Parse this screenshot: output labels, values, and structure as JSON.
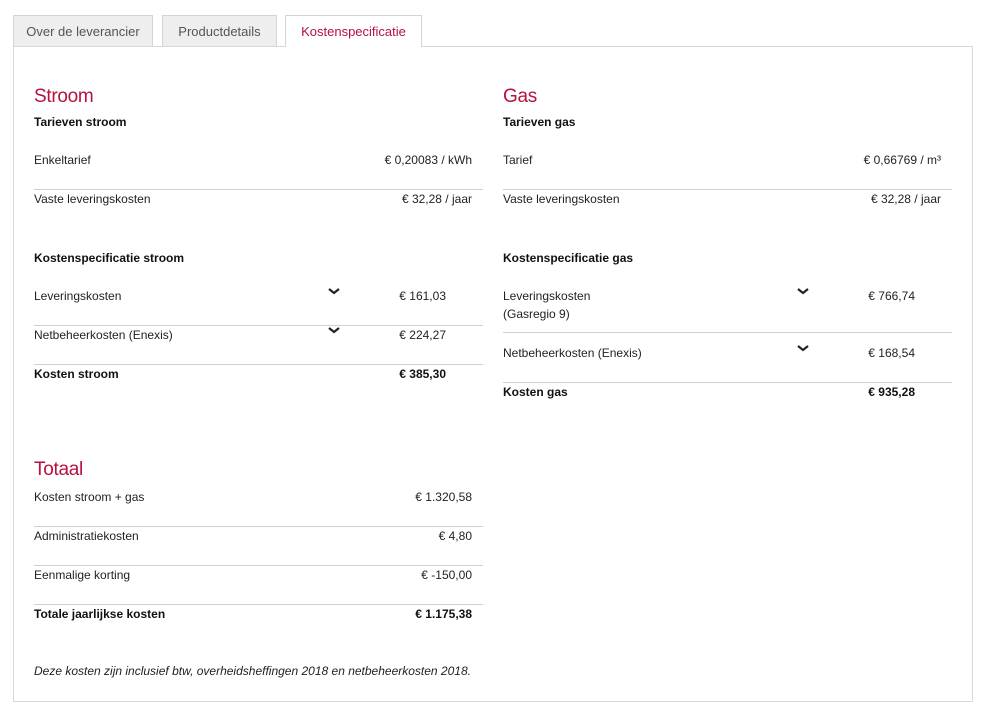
{
  "tabs": [
    {
      "label": "Over de leverancier"
    },
    {
      "label": "Productdetails"
    },
    {
      "label": "Kostenspecificatie"
    }
  ],
  "stroom": {
    "title": "Stroom",
    "tarieven_title": "Tarieven stroom",
    "tarieven": [
      {
        "label": "Enkeltarief",
        "value": "€ 0,20083 / kWh"
      },
      {
        "label": "Vaste leveringskosten",
        "value": "€ 32,28 / jaar"
      }
    ],
    "spec_title": "Kostenspecificatie stroom",
    "spec": [
      {
        "label": "Leveringskosten",
        "value": "€ 161,03"
      },
      {
        "label": "Netbeheerkosten (Enexis)",
        "value": "€ 224,27"
      }
    ],
    "total_label": "Kosten stroom",
    "total_value": "€ 385,30"
  },
  "gas": {
    "title": "Gas",
    "tarieven_title": "Tarieven gas",
    "tarieven": [
      {
        "label": "Tarief",
        "value": "€ 0,66769 / m³"
      },
      {
        "label": "Vaste leveringskosten",
        "value": "€ 32,28 / jaar"
      }
    ],
    "spec_title": "Kostenspecificatie gas",
    "spec": [
      {
        "label": "Leveringskosten",
        "label2": "(Gasregio 9)",
        "value": "€ 766,74"
      },
      {
        "label": "Netbeheerkosten (Enexis)",
        "value": "€ 168,54"
      }
    ],
    "total_label": "Kosten gas",
    "total_value": "€ 935,28"
  },
  "totaal": {
    "title": "Totaal",
    "rows": [
      {
        "label": "Kosten stroom + gas",
        "value": "€ 1.320,58"
      },
      {
        "label": "Administratiekosten",
        "value": "€ 4,80"
      },
      {
        "label": "Eenmalige korting",
        "value": "€ -150,00"
      }
    ],
    "total_label": "Totale jaarlijkse kosten",
    "total_value": "€ 1.175,38"
  },
  "note": "Deze kosten zijn inclusief btw, overheidsheffingen 2018 en netbeheerkosten 2018.",
  "colors": {
    "accent": "#b5123f",
    "divider": "#cfcfcf"
  },
  "icons": {
    "expand": "chevron-down-icon"
  }
}
